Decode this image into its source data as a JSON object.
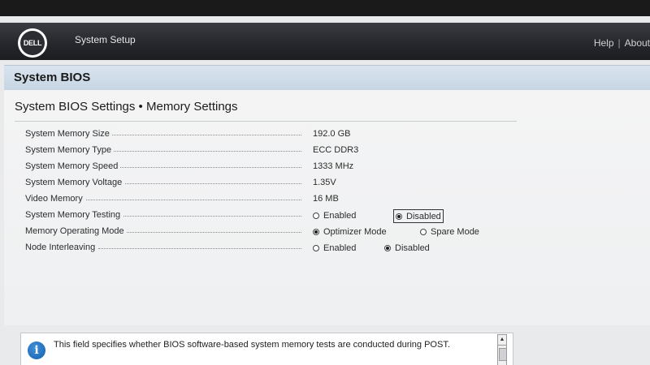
{
  "header": {
    "logo_text": "DELL",
    "app_title": "System Setup",
    "help_link": "Help",
    "separator": "|",
    "about_link": "About"
  },
  "section": {
    "title": "System BIOS",
    "breadcrumb": "System BIOS Settings • Memory Settings"
  },
  "settings": [
    {
      "label": "System Memory Size",
      "value": "192.0 GB"
    },
    {
      "label": "System Memory Type",
      "value": "ECC DDR3"
    },
    {
      "label": "System Memory Speed",
      "value": "1333 MHz"
    },
    {
      "label": "System Memory Voltage",
      "value": "1.35V"
    },
    {
      "label": "Video Memory",
      "value": "16 MB"
    },
    {
      "label": "System Memory Testing",
      "options": [
        "Enabled",
        "Disabled"
      ],
      "selected": "Disabled"
    },
    {
      "label": "Memory Operating Mode",
      "options": [
        "Optimizer Mode",
        "Spare Mode"
      ],
      "selected": "Optimizer Mode"
    },
    {
      "label": "Node Interleaving",
      "options": [
        "Enabled",
        "Disabled"
      ],
      "selected": "Disabled"
    }
  ],
  "help": {
    "icon": "info-icon",
    "text": "This field specifies whether BIOS software-based system memory tests are conducted during POST."
  },
  "colors": {
    "topbar": "#24262b",
    "header_band": "#c7d5e3",
    "info_blue": "#1560ad"
  }
}
